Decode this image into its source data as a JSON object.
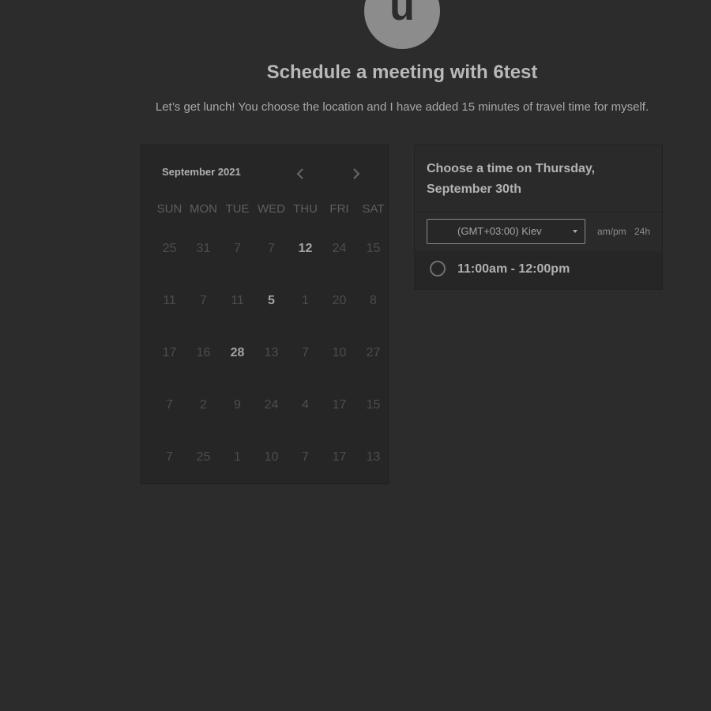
{
  "avatar": {
    "letter": "u"
  },
  "header": {
    "title": "Schedule a meeting with 6test",
    "description": "Let’s get lunch! You choose the location and I have added 15 minutes of travel time for myself."
  },
  "calendar": {
    "month_label": "September 2021",
    "weekdays": [
      "SUN",
      "MON",
      "TUE",
      "WED",
      "THU",
      "FRI",
      "SAT"
    ],
    "days": [
      {
        "label": "25",
        "active": false
      },
      {
        "label": "31",
        "active": false
      },
      {
        "label": "7",
        "active": false
      },
      {
        "label": "7",
        "active": false
      },
      {
        "label": "12",
        "active": true
      },
      {
        "label": "24",
        "active": false
      },
      {
        "label": "15",
        "active": false
      },
      {
        "label": "11",
        "active": false
      },
      {
        "label": "7",
        "active": false
      },
      {
        "label": "11",
        "active": false
      },
      {
        "label": "5",
        "active": true
      },
      {
        "label": "1",
        "active": false
      },
      {
        "label": "20",
        "active": false
      },
      {
        "label": "8",
        "active": false
      },
      {
        "label": "17",
        "active": false
      },
      {
        "label": "16",
        "active": false
      },
      {
        "label": "28",
        "active": true
      },
      {
        "label": "13",
        "active": false
      },
      {
        "label": "7",
        "active": false
      },
      {
        "label": "10",
        "active": false
      },
      {
        "label": "27",
        "active": false
      },
      {
        "label": "7",
        "active": false
      },
      {
        "label": "2",
        "active": false
      },
      {
        "label": "9",
        "active": false
      },
      {
        "label": "24",
        "active": false
      },
      {
        "label": "4",
        "active": false
      },
      {
        "label": "17",
        "active": false
      },
      {
        "label": "15",
        "active": false
      },
      {
        "label": "7",
        "active": false
      },
      {
        "label": "25",
        "active": false
      },
      {
        "label": "1",
        "active": false
      },
      {
        "label": "10",
        "active": false
      },
      {
        "label": "7",
        "active": false
      },
      {
        "label": "17",
        "active": false
      },
      {
        "label": "13",
        "active": false
      }
    ]
  },
  "times": {
    "heading": "Choose a time on Thursday, September 30th",
    "timezone": "(GMT+03:00) Kiev",
    "format_ampm": "am/pm",
    "format_24h": "24h",
    "slots": [
      "11:00am - 12:00pm"
    ]
  },
  "colors": {
    "background": "#2c2c2c",
    "avatar": "#8c8c8c",
    "active_day": "#a4a4a4",
    "inactive_day": "#4d4d4d"
  }
}
